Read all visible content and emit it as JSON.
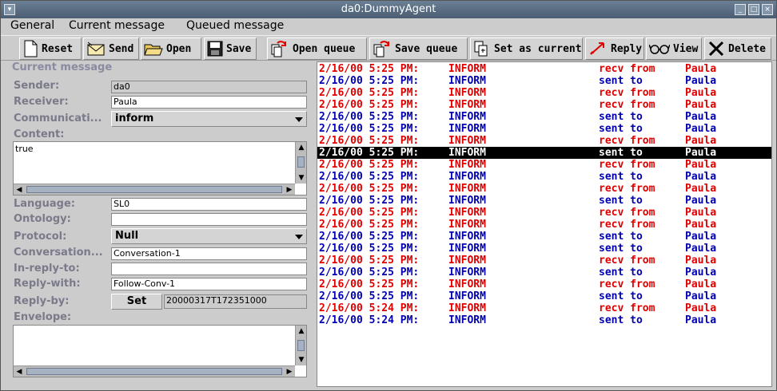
{
  "window": {
    "title": "da0:DummyAgent"
  },
  "menu": [
    "General",
    "Current message",
    "Queued message"
  ],
  "toolbar": {
    "reset": "Reset",
    "send": "Send",
    "open": "Open",
    "save": "Save",
    "open_queue": "Open queue",
    "save_queue": "Save queue",
    "set_as_current": "Set as current",
    "reply": "Reply",
    "view": "View",
    "delete": "Delete"
  },
  "form": {
    "section_title": "Current message",
    "sender_label": "Sender:",
    "sender_value": "da0",
    "receiver_label": "Receiver:",
    "receiver_value": "Paula",
    "communicative_label": "Communicati...",
    "communicative_value": "inform",
    "content_label": "Content:",
    "content_value": "true",
    "language_label": "Language:",
    "language_value": "SL0",
    "ontology_label": "Ontology:",
    "ontology_value": "",
    "protocol_label": "Protocol:",
    "protocol_value": "Null",
    "conversation_label": "Conversation...",
    "conversation_value": "Conversation-1",
    "inreplyto_label": "In-reply-to:",
    "inreplyto_value": "",
    "replywith_label": "Reply-with:",
    "replywith_value": "Follow-Conv-1",
    "replyby_label": "Reply-by:",
    "set_label": "Set",
    "replyby_value": "20000317T172351000",
    "envelope_label": "Envelope:"
  },
  "colors": {
    "recv": "#e00000",
    "sent": "#0000b0"
  },
  "messages": [
    {
      "ts": "2/16/00 5:25 PM:",
      "perf": "INFORM",
      "dir": "recv from",
      "who": "Paula",
      "type": "recv"
    },
    {
      "ts": "2/16/00 5:25 PM:",
      "perf": "INFORM",
      "dir": "sent to",
      "who": "Paula",
      "type": "sent"
    },
    {
      "ts": "2/16/00 5:25 PM:",
      "perf": "INFORM",
      "dir": "recv from",
      "who": "Paula",
      "type": "recv"
    },
    {
      "ts": "2/16/00 5:25 PM:",
      "perf": "INFORM",
      "dir": "recv from",
      "who": "Paula",
      "type": "recv"
    },
    {
      "ts": "2/16/00 5:25 PM:",
      "perf": "INFORM",
      "dir": "sent to",
      "who": "Paula",
      "type": "sent"
    },
    {
      "ts": "2/16/00 5:25 PM:",
      "perf": "INFORM",
      "dir": "sent to",
      "who": "Paula",
      "type": "sent"
    },
    {
      "ts": "2/16/00 5:25 PM:",
      "perf": "INFORM",
      "dir": "recv from",
      "who": "Paula",
      "type": "recv"
    },
    {
      "ts": "2/16/00 5:25 PM:",
      "perf": "INFORM",
      "dir": "sent to",
      "who": "Paula",
      "type": "sent",
      "selected": true
    },
    {
      "ts": "2/16/00 5:25 PM:",
      "perf": "INFORM",
      "dir": "recv from",
      "who": "Paula",
      "type": "recv"
    },
    {
      "ts": "2/16/00 5:25 PM:",
      "perf": "INFORM",
      "dir": "sent to",
      "who": "Paula",
      "type": "sent"
    },
    {
      "ts": "2/16/00 5:25 PM:",
      "perf": "INFORM",
      "dir": "recv from",
      "who": "Paula",
      "type": "recv"
    },
    {
      "ts": "2/16/00 5:25 PM:",
      "perf": "INFORM",
      "dir": "sent to",
      "who": "Paula",
      "type": "sent"
    },
    {
      "ts": "2/16/00 5:25 PM:",
      "perf": "INFORM",
      "dir": "recv from",
      "who": "Paula",
      "type": "recv"
    },
    {
      "ts": "2/16/00 5:25 PM:",
      "perf": "INFORM",
      "dir": "recv from",
      "who": "Paula",
      "type": "recv"
    },
    {
      "ts": "2/16/00 5:25 PM:",
      "perf": "INFORM",
      "dir": "sent to",
      "who": "Paula",
      "type": "sent"
    },
    {
      "ts": "2/16/00 5:25 PM:",
      "perf": "INFORM",
      "dir": "sent to",
      "who": "Paula",
      "type": "sent"
    },
    {
      "ts": "2/16/00 5:25 PM:",
      "perf": "INFORM",
      "dir": "recv from",
      "who": "Paula",
      "type": "recv"
    },
    {
      "ts": "2/16/00 5:25 PM:",
      "perf": "INFORM",
      "dir": "sent to",
      "who": "Paula",
      "type": "sent"
    },
    {
      "ts": "2/16/00 5:25 PM:",
      "perf": "INFORM",
      "dir": "recv from",
      "who": "Paula",
      "type": "recv"
    },
    {
      "ts": "2/16/00 5:25 PM:",
      "perf": "INFORM",
      "dir": "sent to",
      "who": "Paula",
      "type": "sent"
    },
    {
      "ts": "2/16/00 5:24 PM:",
      "perf": "INFORM",
      "dir": "recv from",
      "who": "Paula",
      "type": "recv"
    },
    {
      "ts": "2/16/00 5:24 PM:",
      "perf": "INFORM",
      "dir": "sent to",
      "who": "Paula",
      "type": "sent"
    }
  ]
}
